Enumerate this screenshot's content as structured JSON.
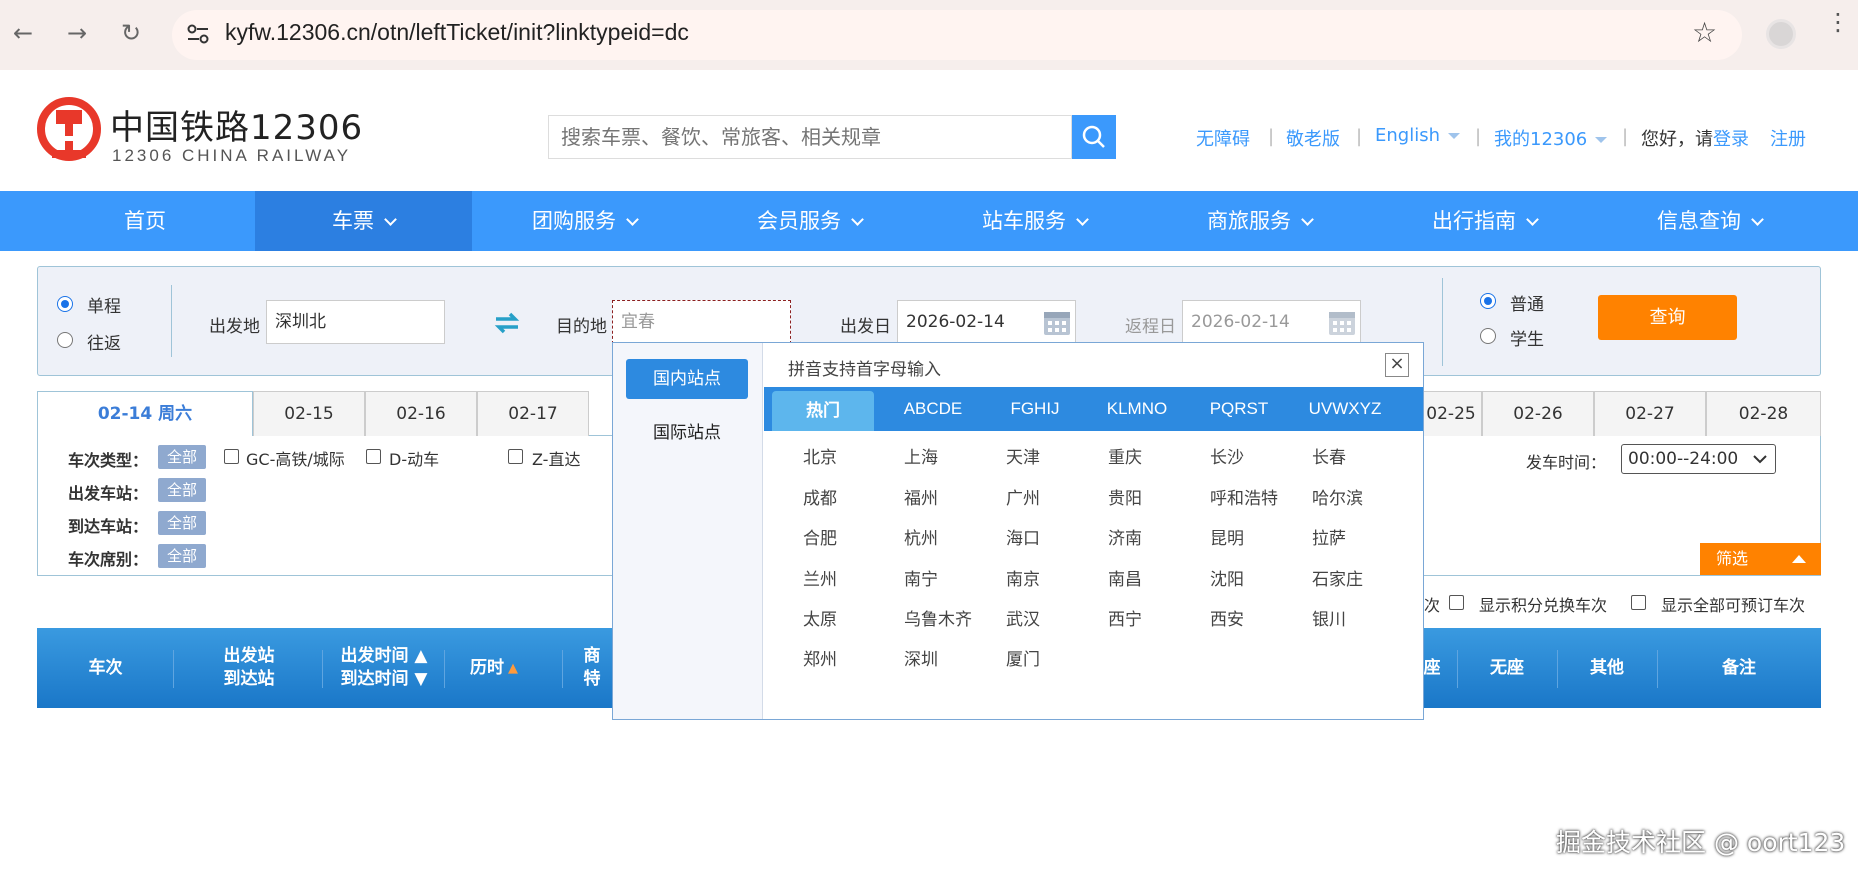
{
  "browser": {
    "url": "kyfw.12306.cn/otn/leftTicket/init?linktypeid=dc"
  },
  "header": {
    "logo_title": "中国铁路12306",
    "logo_sub": "12306 CHINA RAILWAY",
    "search_placeholder": "搜索车票、餐饮、常旅客、相关规章",
    "links": {
      "accessible": "无障碍",
      "elder": "敬老版",
      "english": "English",
      "my12306": "我的12306",
      "greeting": "您好，请",
      "login": "登录",
      "register": "注册"
    }
  },
  "nav": [
    "首页",
    "车票",
    "团购服务",
    "会员服务",
    "站车服务",
    "商旅服务",
    "出行指南",
    "信息查询"
  ],
  "query": {
    "one_way": "单程",
    "round_trip": "往返",
    "from_label": "出发地",
    "from_value": "深圳北",
    "to_label": "目的地",
    "to_value": "宜春",
    "depart_label": "出发日",
    "depart_value": "2026-02-14",
    "return_label": "返程日",
    "return_value": "2026-02-14",
    "normal": "普通",
    "student": "学生",
    "query_button": "查询"
  },
  "dates": {
    "active": "02-14 周六",
    "items": [
      "02-15",
      "02-16",
      "02-17",
      "02-25",
      "02-26",
      "02-27",
      "02-28"
    ]
  },
  "filter": {
    "train_type_label": "车次类型：",
    "depart_station_label": "出发车站：",
    "arrive_station_label": "到达车站：",
    "seat_label": "车次席别：",
    "all": "全部",
    "types": [
      "GC-高铁/城际",
      "D-动车",
      "Z-直达"
    ],
    "depart_time_label": "发车时间：",
    "depart_time_value": "00:00--24:00",
    "filter_button": "筛选"
  },
  "options": {
    "partial": "次",
    "points": "显示积分兑换车次",
    "all_bookable": "显示全部可预订车次"
  },
  "results_header": {
    "train": "车次",
    "stations_1": "出发站",
    "stations_2": "到达站",
    "times_1": "出发时间",
    "times_2": "到达时间",
    "duration": "历时",
    "shang_1": "商",
    "shang_2": "特",
    "partial_seat": "座",
    "no_seat": "无座",
    "other": "其他",
    "remarks": "备注"
  },
  "popup": {
    "tab_domestic": "国内站点",
    "tab_intl": "国际站点",
    "title": "拼音支持首字母输入",
    "close": "×",
    "letter_tabs": [
      "热门",
      "ABCDE",
      "FGHIJ",
      "KLMNO",
      "PQRST",
      "UVWXYZ"
    ],
    "cities": [
      [
        "北京",
        "上海",
        "天津",
        "重庆",
        "长沙",
        "长春"
      ],
      [
        "成都",
        "福州",
        "广州",
        "贵阳",
        "呼和浩特",
        "哈尔滨"
      ],
      [
        "合肥",
        "杭州",
        "海口",
        "济南",
        "昆明",
        "拉萨"
      ],
      [
        "兰州",
        "南宁",
        "南京",
        "南昌",
        "沈阳",
        "石家庄"
      ],
      [
        "太原",
        "乌鲁木齐",
        "武汉",
        "西宁",
        "西安",
        "银川"
      ],
      [
        "郑州",
        "深圳",
        "厦门"
      ]
    ]
  },
  "watermark": "掘金技术社区 @ oort123",
  "colors": {
    "brand_blue": "#3b99fc",
    "accent_orange": "#ff8200",
    "logo_red": "#e8382a"
  }
}
